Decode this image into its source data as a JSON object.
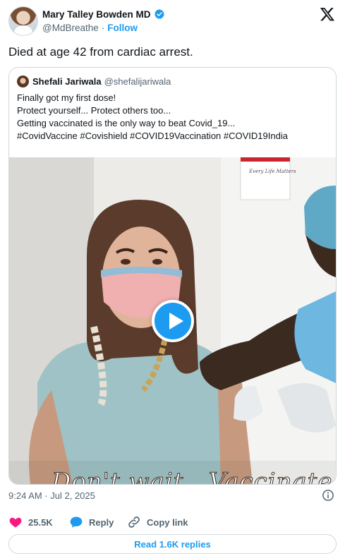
{
  "author": {
    "display_name": "Mary Talley Bowden MD",
    "handle": "@MdBreathe",
    "separator": "·",
    "follow_label": "Follow"
  },
  "tweet": {
    "text": "Died at age 42 from cardiac arrest.",
    "timestamp": "9:24 AM · Jul 2, 2025"
  },
  "quoted_tweet": {
    "display_name": "Shefali Jariwala",
    "handle": "@shefalijariwala",
    "lines": [
      "Finally got my first dose!",
      "Protect yourself... Protect others too...",
      "Getting vaccinated is the only way to beat Covid_19...",
      "#CovidVaccine #Covishield #COVID19Vaccination #COVID19India"
    ],
    "media": {
      "poster_text": "Every Life Matters",
      "caption": "Don't wait...Vaccinate"
    }
  },
  "actions": {
    "likes": "25.5K",
    "reply_label": "Reply",
    "copy_link_label": "Copy link"
  },
  "read_replies_label": "Read 1.6K replies",
  "colors": {
    "accent": "#1d9bf0",
    "like": "#f91880",
    "text": "#0f1419",
    "muted": "#536471",
    "border": "#cfd9de"
  },
  "icons": [
    "verified-badge-icon",
    "x-logo-icon",
    "play-icon",
    "info-icon",
    "heart-icon",
    "reply-bubble-icon",
    "link-icon"
  ]
}
